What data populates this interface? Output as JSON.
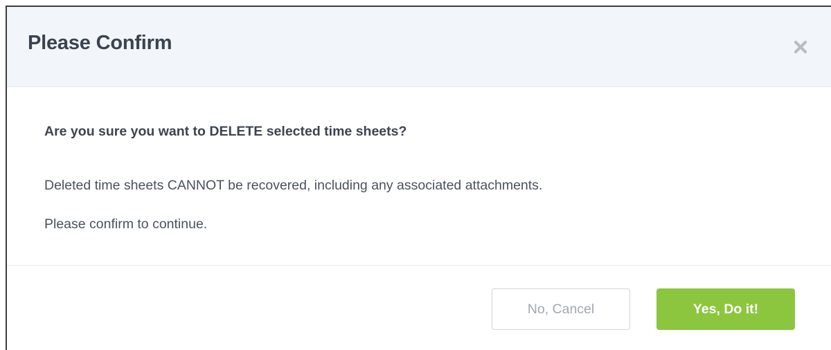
{
  "dialog": {
    "title": "Please Confirm",
    "close_icon": "close-icon",
    "question": "Are you sure you want to DELETE selected time sheets?",
    "info_lines": [
      "Deleted time sheets CANNOT be recovered, including any associated attachments.",
      "Please confirm to continue."
    ],
    "buttons": {
      "cancel_label": "No, Cancel",
      "confirm_label": "Yes, Do it!"
    }
  },
  "colors": {
    "header_background": "#f2f5f9",
    "confirm_button": "#8cc63f",
    "cancel_text": "#a2a9b2",
    "title_text": "#3a4350"
  }
}
